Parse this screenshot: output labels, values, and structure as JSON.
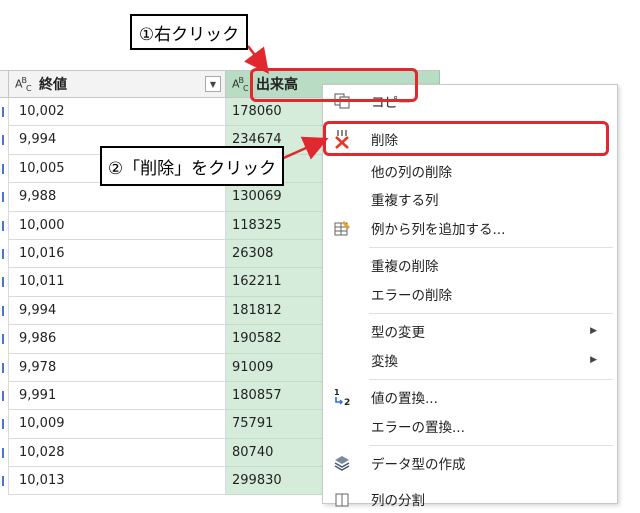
{
  "columns": {
    "close": {
      "type_icon": "ABC",
      "label": "終値"
    },
    "volume": {
      "type_icon": "ABC",
      "label": "出来高"
    }
  },
  "rows": [
    {
      "close": "10,002",
      "volume": "178060"
    },
    {
      "close": "9,994",
      "volume": "234674"
    },
    {
      "close": "10,005",
      "volume": ""
    },
    {
      "close": "9,988",
      "volume": "130069"
    },
    {
      "close": "10,000",
      "volume": "118325"
    },
    {
      "close": "10,016",
      "volume": "26308"
    },
    {
      "close": "10,011",
      "volume": "162211"
    },
    {
      "close": "9,994",
      "volume": "181812"
    },
    {
      "close": "9,986",
      "volume": "190582"
    },
    {
      "close": "9,978",
      "volume": "91009"
    },
    {
      "close": "9,991",
      "volume": "180857"
    },
    {
      "close": "10,009",
      "volume": "75791"
    },
    {
      "close": "10,028",
      "volume": "80740"
    },
    {
      "close": "10,013",
      "volume": "299830"
    }
  ],
  "menu": {
    "copy": "コピー",
    "delete": "削除",
    "delete_others": "他の列の削除",
    "duplicate": "重複する列",
    "add_from_examples": "例から列を追加する...",
    "remove_duplicates": "重複の削除",
    "remove_errors": "エラーの削除",
    "change_type": "型の変更",
    "transform": "変換",
    "replace_values": "値の置換...",
    "replace_errors": "エラーの置換...",
    "create_data_type": "データ型の作成",
    "split_column": "列の分割"
  },
  "annotations": {
    "step1": "①右クリック",
    "step2": "②「削除」をクリック"
  },
  "colors": {
    "highlight": "#e0282e",
    "selected_column": "#d5ecdb"
  }
}
